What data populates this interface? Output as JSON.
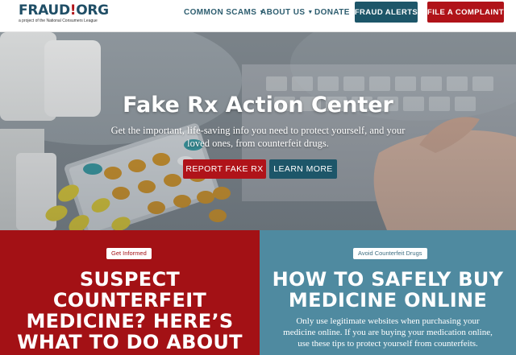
{
  "logo": {
    "word_left": "FRAUD",
    "word_mark": "!",
    "word_right": "ORG",
    "tagline": "a project of the National Consumers League"
  },
  "nav": {
    "common_scams": "COMMON SCAMS",
    "about_us": "ABOUT US",
    "donate": "DONATE",
    "fraud_alerts": "FRAUD ALERTS",
    "file_complaint": "FILE A COMPLAINT"
  },
  "hero": {
    "title": "Fake Rx Action Center",
    "subtitle": "Get the important, life-saving info you need to protect yourself, and your loved ones, from counterfeit drugs.",
    "report_button": "REPORT FAKE RX",
    "learn_button": "LEARN MORE"
  },
  "panels": {
    "left": {
      "badge": "Get Informed",
      "heading_lines": [
        "SUSPECT",
        "COUNTERFEIT",
        "MEDICINE? HERE’S",
        "WHAT TO DO ABOUT"
      ]
    },
    "right": {
      "badge": "Avoid Counterfeit Drugs",
      "heading_lines": [
        "HOW TO SAFELY BUY",
        "MEDICINE ONLINE"
      ],
      "body": "Only use legitimate websites when purchasing your medicine online. If you are buying your medication online, use these tips to protect yourself from counterfeits."
    }
  },
  "colors": {
    "brand_teal": "#1d5669",
    "brand_red": "#b01319",
    "panel_red": "#a31115",
    "panel_blue": "#4f8aa0",
    "nav_text": "#2d5d6f"
  },
  "icons": {
    "dropdown": "caret-down-icon"
  }
}
